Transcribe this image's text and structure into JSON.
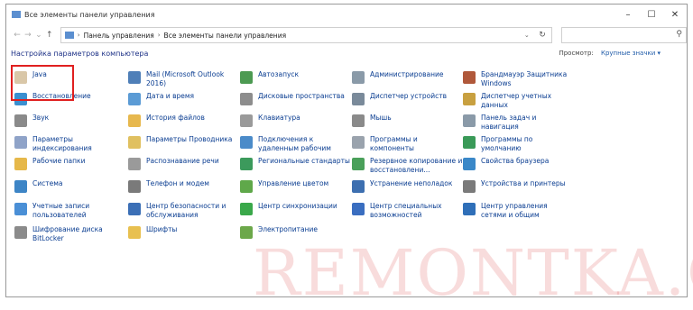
{
  "window": {
    "title": "Все элементы панели управления",
    "minimize_glyph": "–",
    "maximize_glyph": "☐",
    "close_glyph": "✕"
  },
  "navbar": {
    "back_glyph": "←",
    "forward_glyph": "→",
    "dropdown_glyph": "⌄",
    "up_glyph": "↑",
    "breadcrumbs": [
      "Панель управления",
      "Все элементы панели управления"
    ],
    "separator": "›",
    "addr_chev": "⌄",
    "refresh_glyph": "↻",
    "search_placeholder": "",
    "search_glyph": "⚲"
  },
  "heading": "Настройка параметров компьютера",
  "view_by": {
    "label": "Просмотр:",
    "value": "Крупные значки ▾"
  },
  "items": [
    {
      "label": "Java",
      "icon": "java-icon",
      "color": "#d9c7a8"
    },
    {
      "label": "Восстановление",
      "icon": "recovery-icon",
      "color": "#3a8fd0"
    },
    {
      "label": "Звук",
      "icon": "sound-icon",
      "color": "#8a8a8a"
    },
    {
      "label": "Параметры индексирования",
      "icon": "indexing-icon",
      "color": "#8fa3c8"
    },
    {
      "label": "Рабочие папки",
      "icon": "work-folders-icon",
      "color": "#e6b84a"
    },
    {
      "label": "Система",
      "icon": "system-icon",
      "color": "#3d85c6"
    },
    {
      "label": "Учетные записи пользователей",
      "icon": "users-icon",
      "color": "#4a8fd6"
    },
    {
      "label": "Шифрование диска BitLocker",
      "icon": "bitlocker-icon",
      "color": "#8b8b8b"
    },
    {
      "label": "Mail (Microsoft Outlook 2016)",
      "icon": "mail-icon",
      "color": "#4f7fb8"
    },
    {
      "label": "Дата и время",
      "icon": "clock-icon",
      "color": "#5b9bd5"
    },
    {
      "label": "История файлов",
      "icon": "file-history-icon",
      "color": "#e7b84e"
    },
    {
      "label": "Параметры Проводника",
      "icon": "explorer-options-icon",
      "color": "#e0c060"
    },
    {
      "label": "Распознавание речи",
      "icon": "microphone-icon",
      "color": "#9a9a9a"
    },
    {
      "label": "Телефон и модем",
      "icon": "phone-icon",
      "color": "#7a7a7a"
    },
    {
      "label": "Центр безопасности и обслуживания",
      "icon": "flag-icon",
      "color": "#3b6fb6"
    },
    {
      "label": "Шрифты",
      "icon": "fonts-icon",
      "color": "#e8c050"
    },
    {
      "label": "Автозапуск",
      "icon": "autoplay-icon",
      "color": "#4c9a52"
    },
    {
      "label": "Дисковые пространства",
      "icon": "storage-icon",
      "color": "#8d8d8d"
    },
    {
      "label": "Клавиатура",
      "icon": "keyboard-icon",
      "color": "#9a9a9a"
    },
    {
      "label": "Подключения к удаленным рабочим",
      "icon": "remote-icon",
      "color": "#4b8bc9"
    },
    {
      "label": "Региональные стандарты",
      "icon": "region-icon",
      "color": "#3c9a5c"
    },
    {
      "label": "Управление цветом",
      "icon": "color-mgmt-icon",
      "color": "#5fa84a"
    },
    {
      "label": "Центр синхронизации",
      "icon": "sync-icon",
      "color": "#3aa84a"
    },
    {
      "label": "Электропитание",
      "icon": "power-icon",
      "color": "#6ca84a"
    },
    {
      "label": "Администрирование",
      "icon": "admin-tools-icon",
      "color": "#8a9aa8"
    },
    {
      "label": "Диспетчер устройств",
      "icon": "device-manager-icon",
      "color": "#7a8a9a"
    },
    {
      "label": "Мышь",
      "icon": "mouse-icon",
      "color": "#8a8a8a"
    },
    {
      "label": "Программы и компоненты",
      "icon": "programs-icon",
      "color": "#9aa3ad"
    },
    {
      "label": "Резервное копирование и восстановлени...",
      "icon": "backup-icon",
      "color": "#4aa05a"
    },
    {
      "label": "Устранение неполадок",
      "icon": "troubleshoot-icon",
      "color": "#3d6fb0"
    },
    {
      "label": "Центр специальных возможностей",
      "icon": "accessibility-icon",
      "color": "#3a6ec0"
    },
    {
      "label": "Брандмауэр Защитника Windows",
      "icon": "firewall-icon",
      "color": "#b0583a"
    },
    {
      "label": "Диспетчер учетных данных",
      "icon": "credentials-icon",
      "color": "#c8a040"
    },
    {
      "label": "Панель задач и навигация",
      "icon": "taskbar-icon",
      "color": "#8a9aa8"
    },
    {
      "label": "Программы по умолчанию",
      "icon": "default-programs-icon",
      "color": "#3a9a58"
    },
    {
      "label": "Свойства браузера",
      "icon": "browser-icon",
      "color": "#3a88c8"
    },
    {
      "label": "Устройства и принтеры",
      "icon": "printer-icon",
      "color": "#7a7a7a"
    },
    {
      "label": "Центр управления сетями и общим",
      "icon": "network-icon",
      "color": "#2f6fb8"
    }
  ],
  "watermark": "REMONTKA.COM"
}
